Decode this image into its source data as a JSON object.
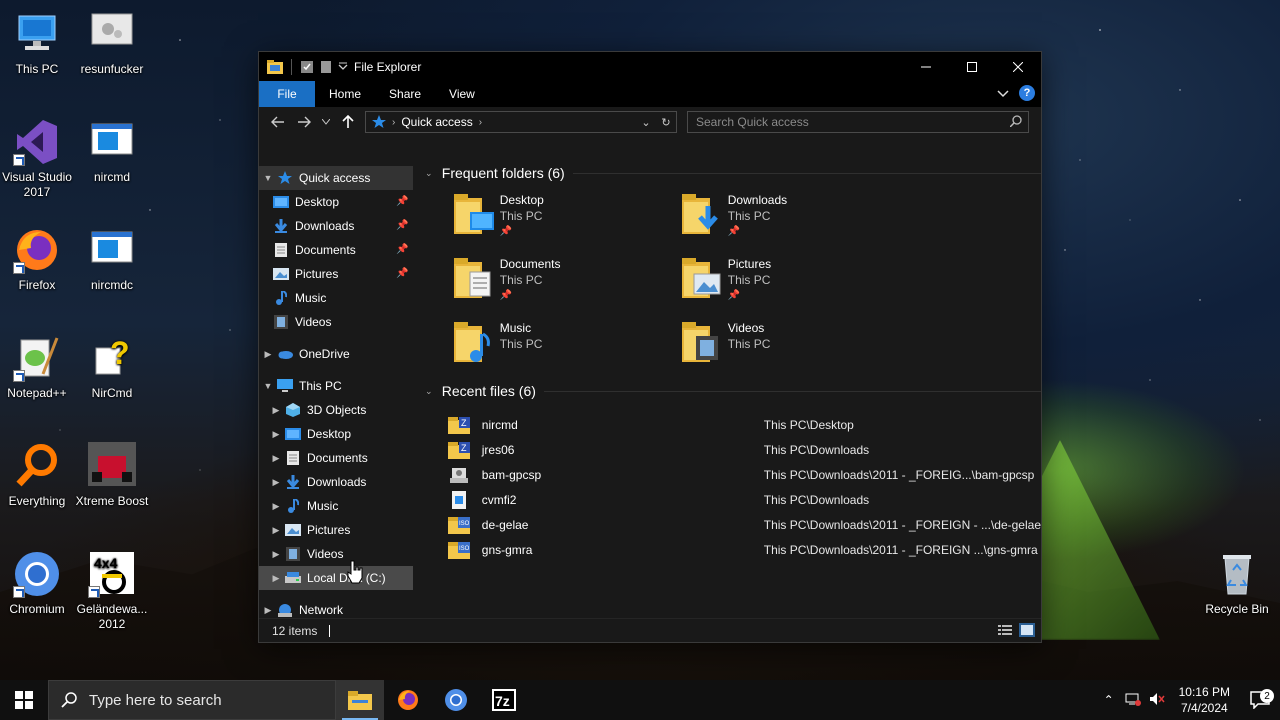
{
  "desktop": {
    "icons": [
      {
        "label": "This PC"
      },
      {
        "label": "resunfucker"
      },
      {
        "label": "Visual Studio 2017"
      },
      {
        "label": "nircmd"
      },
      {
        "label": "Firefox"
      },
      {
        "label": "nircmdc"
      },
      {
        "label": "Notepad++"
      },
      {
        "label": "NirCmd"
      },
      {
        "label": "Everything"
      },
      {
        "label": "Xtreme Boost"
      },
      {
        "label": "Chromium"
      },
      {
        "label": "Geländewa... 2012"
      },
      {
        "label": "Recycle Bin"
      }
    ]
  },
  "explorer": {
    "title": "File Explorer",
    "tabs": {
      "file": "File",
      "home": "Home",
      "share": "Share",
      "view": "View"
    },
    "address": {
      "crumb": "Quick access"
    },
    "search": {
      "placeholder": "Search Quick access"
    },
    "nav": {
      "quick_access": "Quick access",
      "qa_items": [
        "Desktop",
        "Downloads",
        "Documents",
        "Pictures",
        "Music",
        "Videos"
      ],
      "onedrive": "OneDrive",
      "this_pc": "This PC",
      "pc_items": [
        "3D Objects",
        "Desktop",
        "Documents",
        "Downloads",
        "Music",
        "Pictures",
        "Videos",
        "Local Disk (C:)"
      ],
      "network": "Network"
    },
    "frequent": {
      "header": "Frequent folders (6)",
      "items": [
        {
          "name": "Desktop",
          "location": "This PC"
        },
        {
          "name": "Downloads",
          "location": "This PC"
        },
        {
          "name": "Documents",
          "location": "This PC"
        },
        {
          "name": "Pictures",
          "location": "This PC"
        },
        {
          "name": "Music",
          "location": "This PC"
        },
        {
          "name": "Videos",
          "location": "This PC"
        }
      ]
    },
    "recent": {
      "header": "Recent files (6)",
      "items": [
        {
          "name": "nircmd",
          "path": "This PC\\Desktop"
        },
        {
          "name": "jres06",
          "path": "This PC\\Downloads"
        },
        {
          "name": "bam-gpcsp",
          "path": "This PC\\Downloads\\2011 - _FOREIG...\\bam-gpcsp"
        },
        {
          "name": "cvmfi2",
          "path": "This PC\\Downloads"
        },
        {
          "name": "de-gelae",
          "path": "This PC\\Downloads\\2011 - _FOREIGN - ...\\de-gelae"
        },
        {
          "name": "gns-gmra",
          "path": "This PC\\Downloads\\2011 - _FOREIGN ...\\gns-gmra"
        }
      ]
    },
    "status": {
      "items_count": "12 items"
    }
  },
  "taskbar": {
    "search_placeholder": "Type here to search",
    "clock_time": "10:16 PM",
    "clock_date": "7/4/2024",
    "notification_count": "2"
  },
  "colors": {
    "accent": "#1a6fc4",
    "folder_yellow": "#f3c74b",
    "window_bg": "#191919"
  }
}
